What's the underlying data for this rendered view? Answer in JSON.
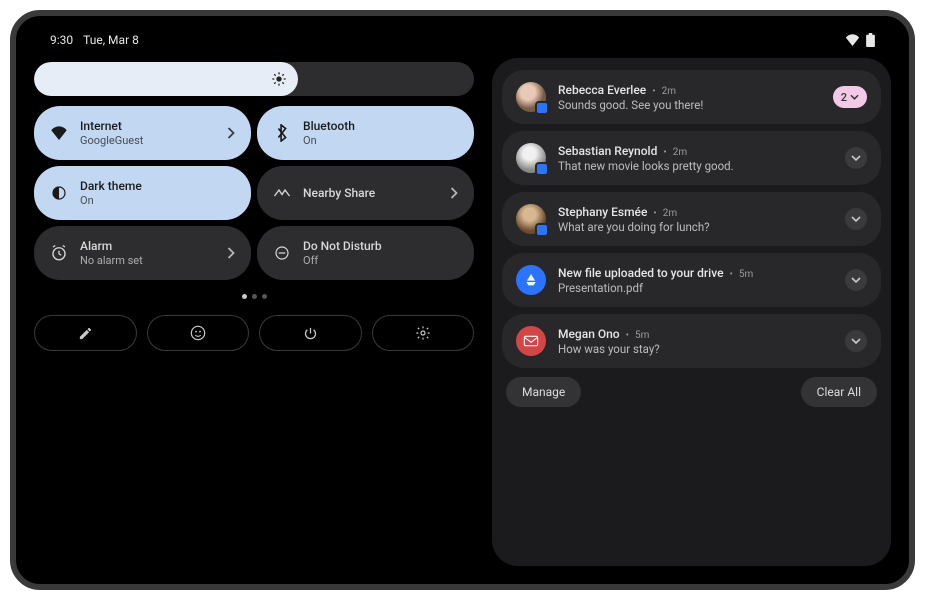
{
  "status": {
    "time": "9:30",
    "date": "Tue, Mar 8"
  },
  "brightness": {
    "percent": 60
  },
  "tiles": [
    {
      "title": "Internet",
      "subtitle": "GoogleGuest",
      "icon": "wifi-icon",
      "active": true,
      "chevron": true
    },
    {
      "title": "Bluetooth",
      "subtitle": "On",
      "icon": "bluetooth-icon",
      "active": true,
      "chevron": false
    },
    {
      "title": "Dark theme",
      "subtitle": "On",
      "icon": "dark-theme-icon",
      "active": true,
      "chevron": false
    },
    {
      "title": "Nearby Share",
      "subtitle": "",
      "icon": "nearby-share-icon",
      "active": false,
      "chevron": true
    },
    {
      "title": "Alarm",
      "subtitle": "No alarm set",
      "icon": "alarm-icon",
      "active": false,
      "chevron": true
    },
    {
      "title": "Do Not Disturb",
      "subtitle": "Off",
      "icon": "dnd-icon",
      "active": false,
      "chevron": false
    }
  ],
  "pagedots": {
    "count": 3,
    "active": 0
  },
  "footer": {
    "buttons": [
      "edit",
      "user",
      "power",
      "settings"
    ]
  },
  "notifications": [
    {
      "title": "Rebecca Everlee",
      "time": "2m",
      "body": "Sounds good. See you there!",
      "avatar": "img1",
      "badge": true,
      "pill_count": "2"
    },
    {
      "title": "Sebastian Reynold",
      "time": "2m",
      "body": "That new movie looks pretty good.",
      "avatar": "img2",
      "badge": true
    },
    {
      "title": "Stephany Esmée",
      "time": "2m",
      "body": "What are you doing for lunch?",
      "avatar": "img3",
      "badge": true
    },
    {
      "title": "New file uploaded to your drive",
      "time": "5m",
      "body": "Presentation.pdf",
      "avatar": "drive"
    },
    {
      "title": "Megan Ono",
      "time": "5m",
      "body": "How was your stay?",
      "avatar": "mail"
    }
  ],
  "notif_actions": {
    "manage": "Manage",
    "clear": "Clear All"
  }
}
